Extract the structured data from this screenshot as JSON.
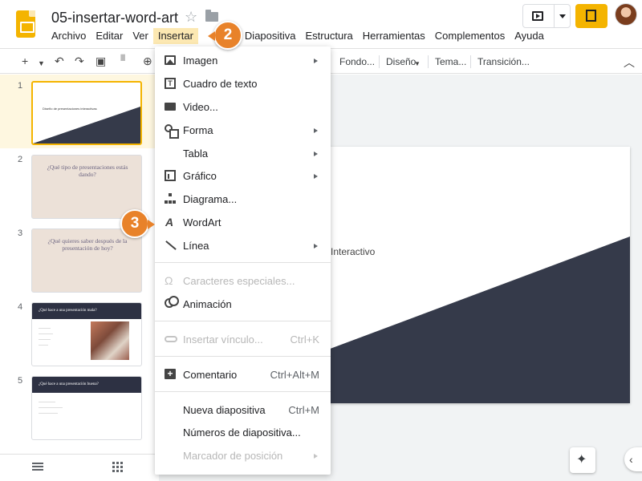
{
  "app": {
    "title": "05-insertar-word-art",
    "menubar": [
      {
        "label": "Archivo",
        "active": false
      },
      {
        "label": "Editar",
        "active": false
      },
      {
        "label": "Ver",
        "active": false
      },
      {
        "label": "Insertar",
        "active": true
      },
      {
        "label": "Diapositiva",
        "active": false
      },
      {
        "label": "Estructura",
        "active": false
      },
      {
        "label": "Herramientas",
        "active": false
      },
      {
        "label": "Complementos",
        "active": false
      },
      {
        "label": "Ayuda",
        "active": false
      }
    ],
    "accent_color": "#f4b400"
  },
  "toolbar": {
    "new_label": "+",
    "background_label": "Fondo...",
    "design_label": "Diseño",
    "theme_label": "Tema...",
    "transition_label": "Transición..."
  },
  "insert_menu": {
    "items": [
      {
        "label": "Imagen",
        "icon": "image-icon",
        "submenu": true,
        "shortcut": "",
        "disabled": false
      },
      {
        "label": "Cuadro de texto",
        "icon": "textbox-icon",
        "submenu": false,
        "shortcut": "",
        "disabled": false
      },
      {
        "label": "Video...",
        "icon": "video-icon",
        "submenu": false,
        "shortcut": "",
        "disabled": false
      },
      {
        "label": "Forma",
        "icon": "shape-icon",
        "submenu": true,
        "shortcut": "",
        "disabled": false
      },
      {
        "label": "Tabla",
        "icon": "",
        "submenu": true,
        "shortcut": "",
        "disabled": false
      },
      {
        "label": "Gráfico",
        "icon": "chart-icon",
        "submenu": true,
        "shortcut": "",
        "disabled": false
      },
      {
        "label": "Diagrama...",
        "icon": "diagram-icon",
        "submenu": false,
        "shortcut": "",
        "disabled": false
      },
      {
        "label": "WordArt",
        "icon": "wordart-icon",
        "submenu": false,
        "shortcut": "",
        "disabled": false
      },
      {
        "label": "Línea",
        "icon": "line-icon",
        "submenu": true,
        "shortcut": "",
        "disabled": false
      },
      {
        "label": "Caracteres especiales...",
        "icon": "omega-icon",
        "submenu": false,
        "shortcut": "",
        "disabled": true
      },
      {
        "label": "Animación",
        "icon": "animation-icon",
        "submenu": false,
        "shortcut": "",
        "disabled": false
      },
      {
        "label": "Insertar vínculo...",
        "icon": "link-icon",
        "submenu": false,
        "shortcut": "Ctrl+K",
        "disabled": true
      },
      {
        "label": "Comentario",
        "icon": "comment-icon",
        "submenu": false,
        "shortcut": "Ctrl+Alt+M",
        "disabled": false
      },
      {
        "label": "Nueva diapositiva",
        "icon": "",
        "submenu": false,
        "shortcut": "Ctrl+M",
        "disabled": false
      },
      {
        "label": "Números de diapositiva...",
        "icon": "",
        "submenu": false,
        "shortcut": "",
        "disabled": false
      },
      {
        "label": "Marcador de posición",
        "icon": "",
        "submenu": true,
        "shortcut": "",
        "disabled": true
      }
    ]
  },
  "slides": [
    {
      "number": "1",
      "title": "Diseño de presentaciones interactivas",
      "style": "title"
    },
    {
      "number": "2",
      "title": "¿Qué tipo de presentaciones estás dando?",
      "style": "beige"
    },
    {
      "number": "3",
      "title": "¿Qué quieres saber después de la presentación de hoy?",
      "style": "beige"
    },
    {
      "number": "4",
      "title": "¿Qué hace a una presentación mala?",
      "style": "dark"
    },
    {
      "number": "5",
      "title": "¿Qué hace a una presentación buena?",
      "style": "dark"
    }
  ],
  "canvas": {
    "visible_text": "Interactivo",
    "dark_color": "#353a4a"
  },
  "steps": {
    "step2": "2",
    "step3": "3"
  }
}
